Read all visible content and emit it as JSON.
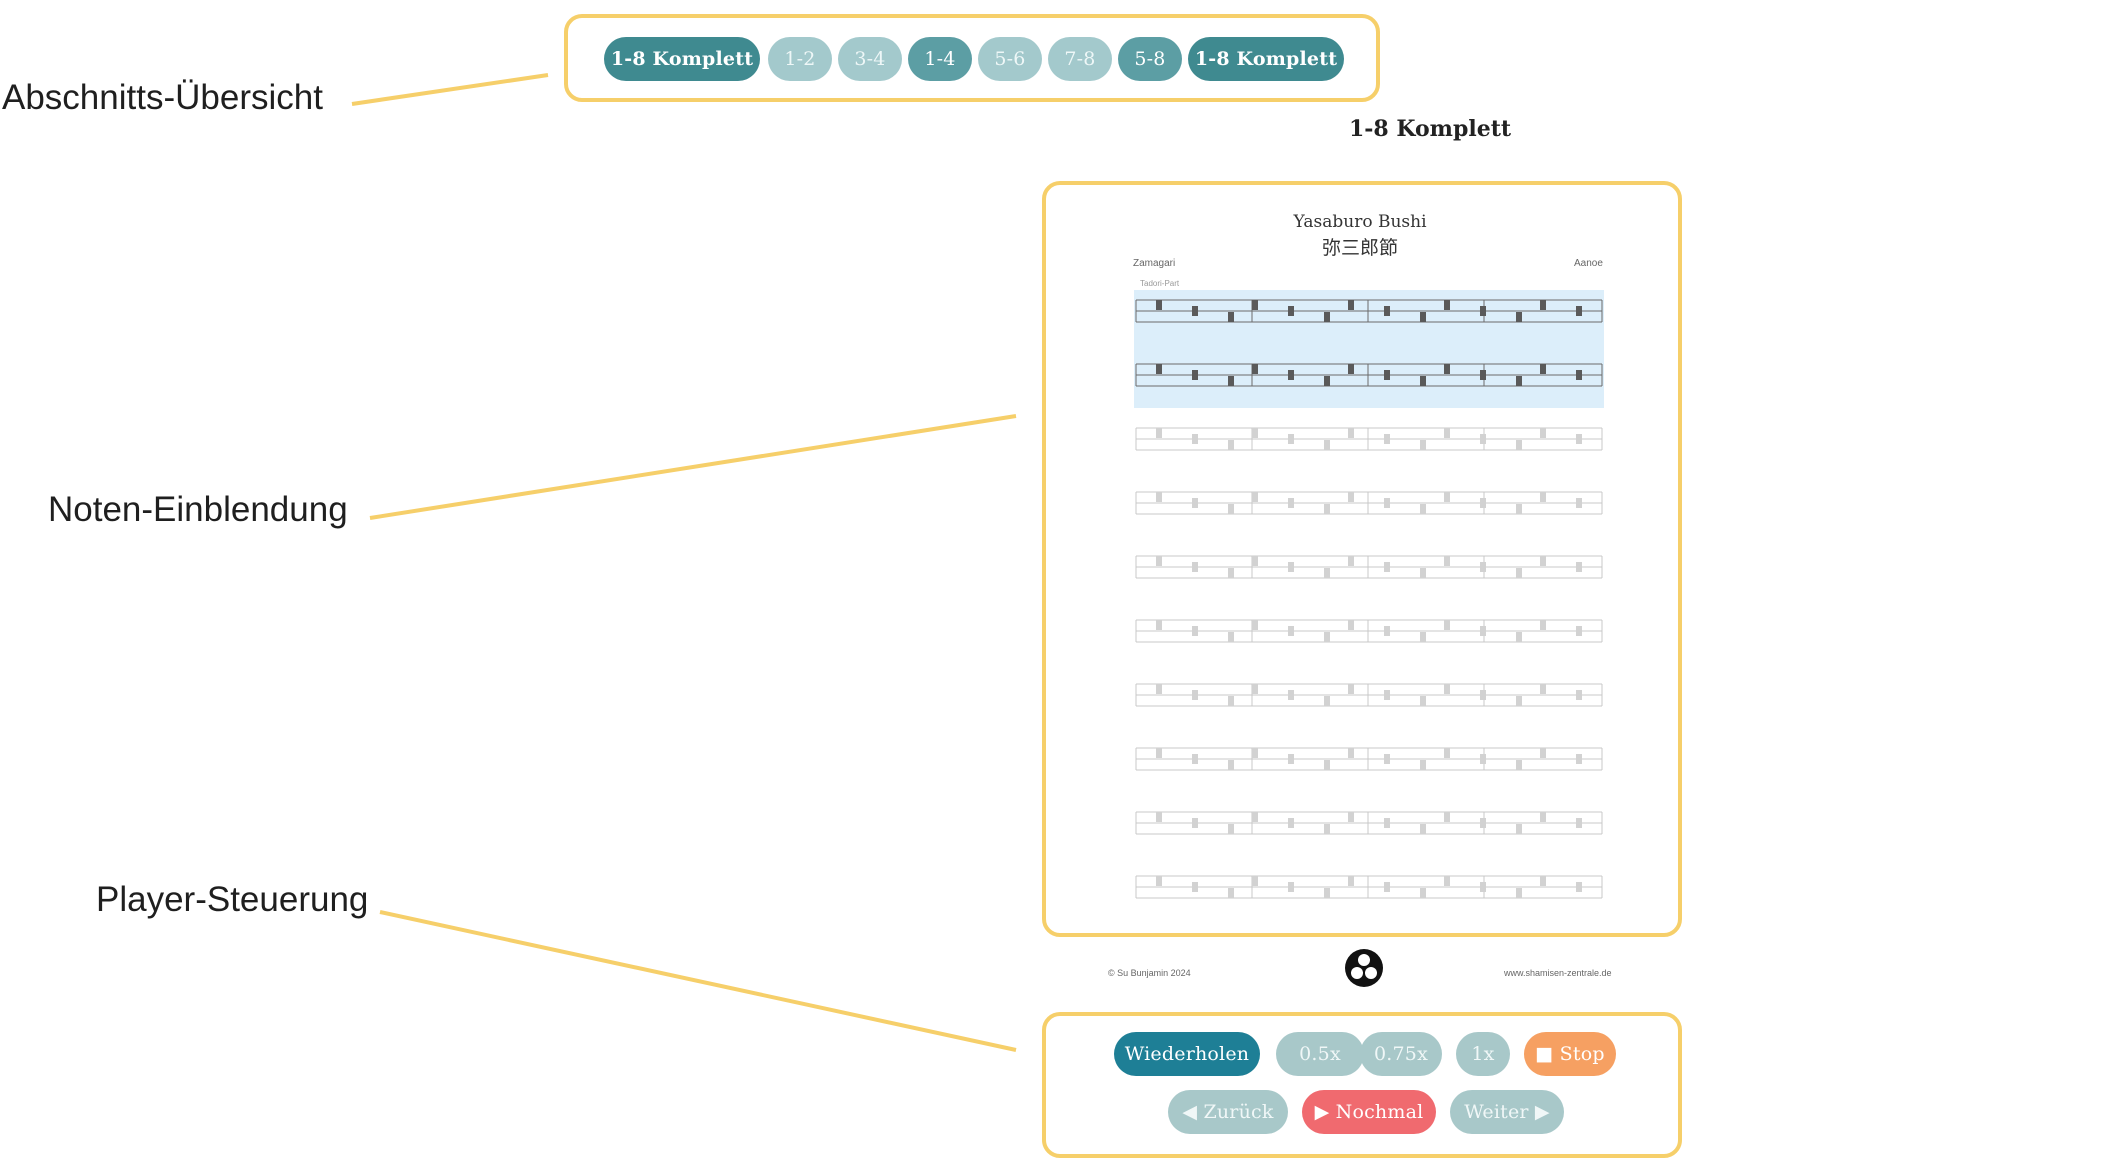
{
  "callouts": {
    "sections": "Abschnitts-Übersicht",
    "notes": "Noten-Einblendung",
    "player": "Player-Steuerung"
  },
  "section_tabs": [
    {
      "label": "1-8 Komplett",
      "state": "active"
    },
    {
      "label": "1-2",
      "state": "inactive"
    },
    {
      "label": "3-4",
      "state": "inactive"
    },
    {
      "label": "1-4",
      "state": "partial"
    },
    {
      "label": "5-6",
      "state": "inactive"
    },
    {
      "label": "7-8",
      "state": "inactive"
    },
    {
      "label": "5-8",
      "state": "partial"
    },
    {
      "label": "1-8 Komplett",
      "state": "active"
    }
  ],
  "current_section": "1-8 Komplett",
  "sheet": {
    "title": "Yasaburo Bushi",
    "title_jp": "弥三郎節",
    "left_meta": "Zamagari",
    "right_meta": "Aanoe",
    "part_label": "Tadori-Part",
    "footer_left": "© Su Bunjamin 2024",
    "footer_right": "www.shamisen-zentrale.de"
  },
  "player": {
    "repeat": "Wiederholen",
    "speed_05": "0.5x",
    "speed_075": "0.75x",
    "speed_1": "1x",
    "stop": "■ Stop",
    "back": "◀ Zurück",
    "again": "▶ Nochmal",
    "next": "Weiter ▶"
  },
  "colors": {
    "accent_frame": "#f6cf6a",
    "teal_dark": "#3f8a90",
    "teal_light": "#a3c9cc",
    "repeat_blue": "#1e7f96",
    "stop_orange": "#f6a062",
    "again_red": "#f06a6f",
    "highlight_blue": "#dceefa"
  }
}
